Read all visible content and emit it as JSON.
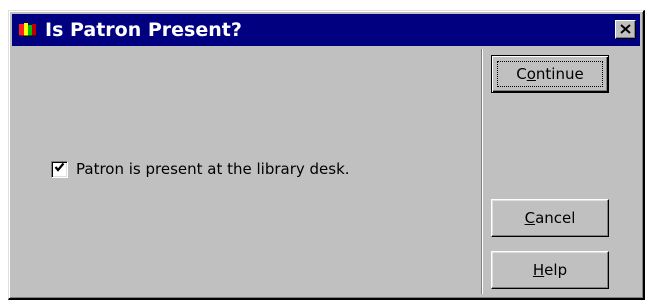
{
  "window": {
    "title": "Is Patron Present?",
    "app_icon": "library-app-icon",
    "close_icon": "close-icon"
  },
  "checkbox": {
    "label": "Patron is present at the library desk.",
    "checked": true
  },
  "buttons": {
    "continue": {
      "mnemonic": "o",
      "before": "C",
      "after": "ntinue",
      "label": "Continue"
    },
    "cancel": {
      "mnemonic": "C",
      "before": "",
      "after": "ancel",
      "label": "Cancel"
    },
    "help": {
      "mnemonic": "H",
      "before": "",
      "after": "elp",
      "label": "Help"
    }
  }
}
